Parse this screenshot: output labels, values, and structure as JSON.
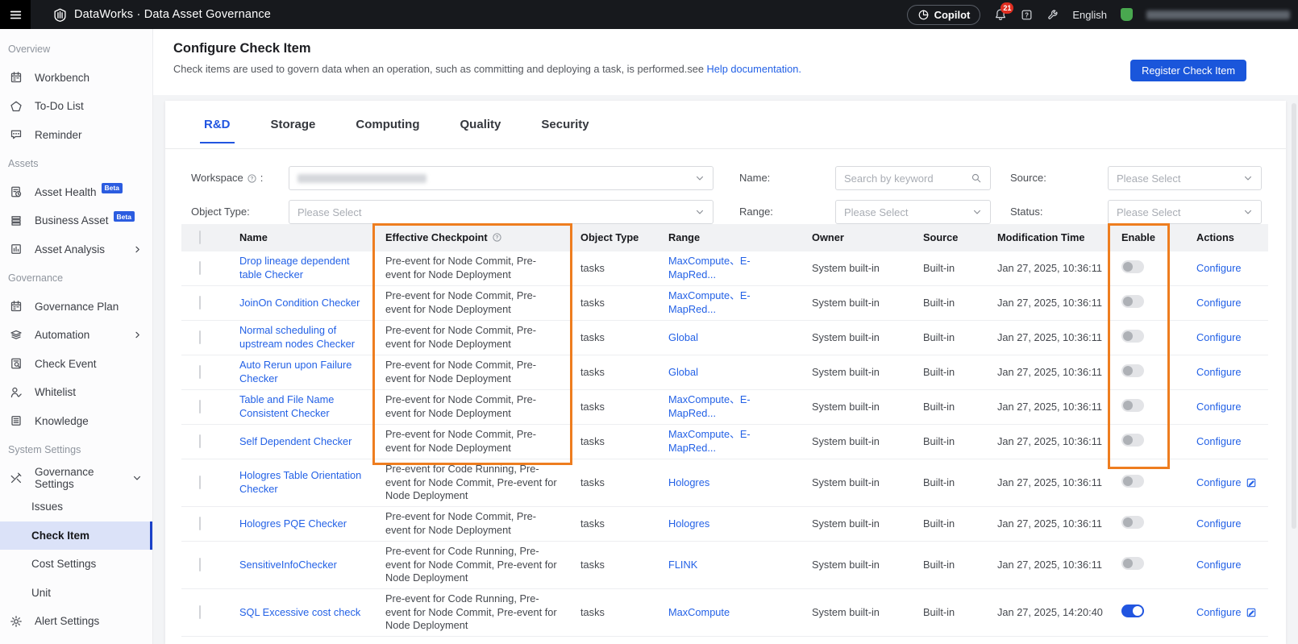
{
  "topbar": {
    "product_title": "DataWorks · Data Asset Governance",
    "copilot_label": "Copilot",
    "notification_count": "21",
    "language": "English",
    "user_email_redacted": true
  },
  "sidebar": {
    "items": [
      {
        "type": "section",
        "label": "Overview"
      },
      {
        "type": "item",
        "icon": "calendar-icon",
        "label": "Workbench"
      },
      {
        "type": "item",
        "icon": "pentagon-icon",
        "label": "To-Do List"
      },
      {
        "type": "item",
        "icon": "comment-icon",
        "label": "Reminder"
      },
      {
        "type": "section",
        "label": "Assets"
      },
      {
        "type": "item",
        "icon": "doc-clock-icon",
        "label": "Asset Health",
        "badge": "Beta"
      },
      {
        "type": "item",
        "icon": "stack-icon",
        "label": "Business Asset",
        "badge": "Beta"
      },
      {
        "type": "item",
        "icon": "doc-chart-icon",
        "label": "Asset Analysis",
        "chevron": "right"
      },
      {
        "type": "section",
        "label": "Governance"
      },
      {
        "type": "item",
        "icon": "calendar-icon",
        "label": "Governance Plan"
      },
      {
        "type": "item",
        "icon": "layers-icon",
        "label": "Automation",
        "chevron": "right"
      },
      {
        "type": "item",
        "icon": "doc-search-icon",
        "label": "Check Event"
      },
      {
        "type": "item",
        "icon": "person-check-icon",
        "label": "Whitelist"
      },
      {
        "type": "item",
        "icon": "doc-lines-icon",
        "label": "Knowledge"
      },
      {
        "type": "section",
        "label": "System Settings"
      },
      {
        "type": "item",
        "icon": "tools-icon",
        "label": "Governance Settings",
        "chevron": "down"
      },
      {
        "type": "subitem",
        "label": "Issues"
      },
      {
        "type": "subitem",
        "label": "Check Item",
        "active": true
      },
      {
        "type": "subitem",
        "label": "Cost Settings"
      },
      {
        "type": "subitem",
        "label": "Unit"
      },
      {
        "type": "item",
        "icon": "gear-icon",
        "label": "Alert Settings"
      }
    ]
  },
  "page_header": {
    "title": "Configure Check Item",
    "description": "Check items are used to govern data when an operation, such as committing and deploying a task, is performed.see ",
    "help_link": "Help documentation.",
    "register_button": "Register Check Item"
  },
  "tabs": [
    {
      "label": "R&D",
      "active": true
    },
    {
      "label": "Storage",
      "active": false
    },
    {
      "label": "Computing",
      "active": false
    },
    {
      "label": "Quality",
      "active": false
    },
    {
      "label": "Security",
      "active": false
    }
  ],
  "filters": {
    "workspace_label": "Workspace",
    "workspace_colon": ":",
    "workspace_value_redacted": true,
    "object_type_label": "Object Type:",
    "name_label": "Name:",
    "range_label": "Range:",
    "source_label": "Source:",
    "status_label": "Status:",
    "search_placeholder": "Search by keyword",
    "please_select": "Please Select"
  },
  "table": {
    "columns": [
      "Name",
      "Effective Checkpoint",
      "Object Type",
      "Range",
      "Owner",
      "Source",
      "Modification Time",
      "Enable",
      "Actions"
    ],
    "rows": [
      {
        "name": "Drop lineage dependent table Checker",
        "checkpoint": "Pre-event for Node Commit, Pre-event for Node Deployment",
        "object_type": "tasks",
        "range": "MaxCompute、E-MapRed...",
        "owner": "System built-in",
        "source": "Built-in",
        "modified": "Jan 27, 2025, 10:36:11",
        "enabled": false,
        "action": "Configure",
        "action_icon": false
      },
      {
        "name": "JoinOn Condition Checker",
        "checkpoint": "Pre-event for Node Commit, Pre-event for Node Deployment",
        "object_type": "tasks",
        "range": "MaxCompute、E-MapRed...",
        "owner": "System built-in",
        "source": "Built-in",
        "modified": "Jan 27, 2025, 10:36:11",
        "enabled": false,
        "action": "Configure",
        "action_icon": false
      },
      {
        "name": "Normal scheduling of upstream nodes Checker",
        "checkpoint": "Pre-event for Node Commit, Pre-event for Node Deployment",
        "object_type": "tasks",
        "range": "Global",
        "owner": "System built-in",
        "source": "Built-in",
        "modified": "Jan 27, 2025, 10:36:11",
        "enabled": false,
        "action": "Configure",
        "action_icon": false
      },
      {
        "name": "Auto Rerun upon Failure Checker",
        "checkpoint": "Pre-event for Node Commit, Pre-event for Node Deployment",
        "object_type": "tasks",
        "range": "Global",
        "owner": "System built-in",
        "source": "Built-in",
        "modified": "Jan 27, 2025, 10:36:11",
        "enabled": false,
        "action": "Configure",
        "action_icon": false
      },
      {
        "name": "Table and File Name Consistent Checker",
        "checkpoint": "Pre-event for Node Commit, Pre-event for Node Deployment",
        "object_type": "tasks",
        "range": "MaxCompute、E-MapRed...",
        "owner": "System built-in",
        "source": "Built-in",
        "modified": "Jan 27, 2025, 10:36:11",
        "enabled": false,
        "action": "Configure",
        "action_icon": false
      },
      {
        "name": "Self Dependent Checker",
        "checkpoint": "Pre-event for Node Commit, Pre-event for Node Deployment",
        "object_type": "tasks",
        "range": "MaxCompute、E-MapRed...",
        "owner": "System built-in",
        "source": "Built-in",
        "modified": "Jan 27, 2025, 10:36:11",
        "enabled": false,
        "action": "Configure",
        "action_icon": false
      },
      {
        "name": "Hologres Table Orientation Checker",
        "checkpoint": "Pre-event for Code Running, Pre-event for Node Commit, Pre-event for Node Deployment",
        "object_type": "tasks",
        "range": "Hologres",
        "owner": "System built-in",
        "source": "Built-in",
        "modified": "Jan 27, 2025, 10:36:11",
        "enabled": false,
        "action": "Configure",
        "action_icon": true
      },
      {
        "name": "Hologres PQE Checker",
        "checkpoint": "Pre-event for Node Commit, Pre-event for Node Deployment",
        "object_type": "tasks",
        "range": "Hologres",
        "owner": "System built-in",
        "source": "Built-in",
        "modified": "Jan 27, 2025, 10:36:11",
        "enabled": false,
        "action": "Configure",
        "action_icon": false
      },
      {
        "name": "SensitiveInfoChecker",
        "checkpoint": "Pre-event for Code Running, Pre-event for Node Commit, Pre-event for Node Deployment",
        "object_type": "tasks",
        "range": "FLINK",
        "owner": "System built-in",
        "source": "Built-in",
        "modified": "Jan 27, 2025, 10:36:11",
        "enabled": false,
        "action": "Configure",
        "action_icon": false
      },
      {
        "name": "SQL Excessive cost check",
        "checkpoint": "Pre-event for Code Running, Pre-event for Node Commit, Pre-event for Node Deployment",
        "object_type": "tasks",
        "range": "MaxCompute",
        "owner": "System built-in",
        "source": "Built-in",
        "modified": "Jan 27, 2025, 14:20:40",
        "enabled": true,
        "action": "Configure",
        "action_icon": true
      }
    ]
  },
  "annotations": {
    "color": "#ee7d1f",
    "boxes": [
      "effective-checkpoint-column",
      "enable-column"
    ]
  }
}
